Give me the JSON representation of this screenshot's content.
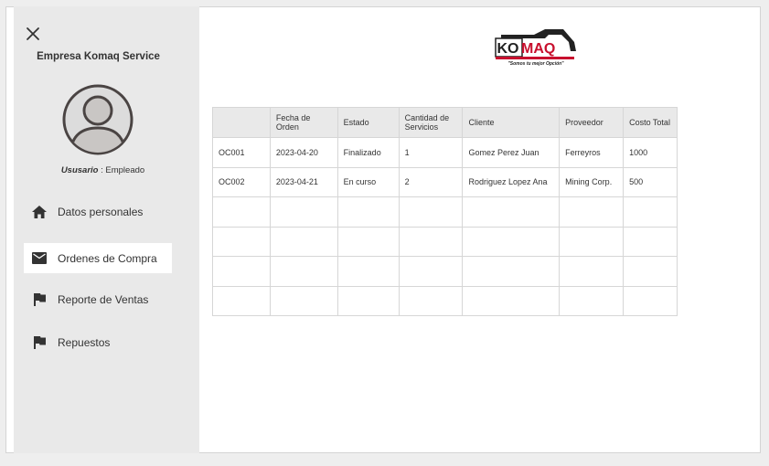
{
  "app": {
    "company_name": "Empresa Komaq Service",
    "user_label": "Ususario",
    "user_separator": " : ",
    "user_role": "Empleado"
  },
  "brand": {
    "logo_text": "KOMAQ",
    "tagline": "\"Somos tu mejor Opción\"",
    "accent_color": "#c8102e"
  },
  "sidebar": {
    "items": [
      {
        "label": "Datos personales",
        "icon": "home-icon",
        "active": false
      },
      {
        "label": "Ordenes de Compra",
        "icon": "mail-icon",
        "active": true
      },
      {
        "label": "Reporte de Ventas",
        "icon": "flag-icon",
        "active": false
      },
      {
        "label": "Repuestos",
        "icon": "flag-icon",
        "active": false
      }
    ]
  },
  "table": {
    "headers": [
      "",
      "Fecha de Orden",
      "Estado",
      "Cantidad de Servicios",
      "Cliente",
      "Proveedor",
      "Costo Total"
    ],
    "rows": [
      [
        "OC001",
        "2023-04-20",
        "Finalizado",
        "1",
        "Gomez Perez Juan",
        "Ferreyros",
        "1000"
      ],
      [
        "OC002",
        "2023-04-21",
        "En curso",
        "2",
        "Rodriguez Lopez Ana",
        "Mining Corp.",
        "500"
      ],
      [
        "",
        "",
        "",
        "",
        "",
        "",
        ""
      ],
      [
        "",
        "",
        "",
        "",
        "",
        "",
        ""
      ],
      [
        "",
        "",
        "",
        "",
        "",
        "",
        ""
      ],
      [
        "",
        "",
        "",
        "",
        "",
        "",
        ""
      ]
    ]
  }
}
